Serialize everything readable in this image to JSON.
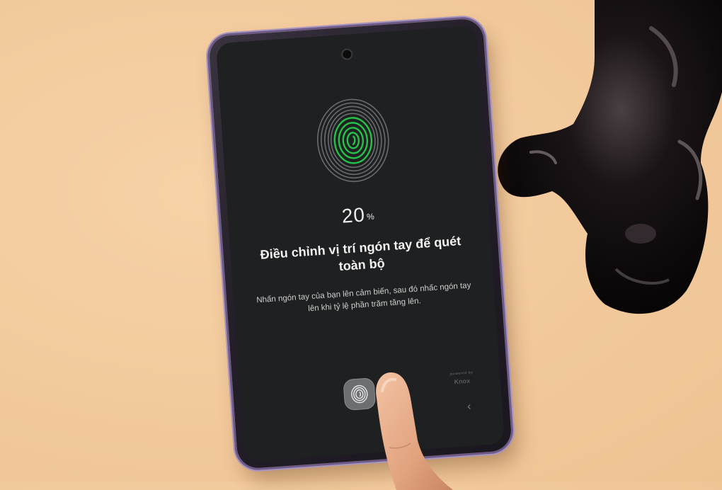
{
  "screen": {
    "progress_value": "20",
    "progress_unit": "%",
    "title": "Điều chỉnh vị trí ngón tay để quét toàn bộ",
    "hint": "Nhấn ngón tay của bạn lên cảm biến, sau đó nhấc ngón tay lên khi tỷ lệ phần trăm tăng lên.",
    "watermark_small": "powered by",
    "watermark_brand": "Knox",
    "progress_fraction": 0.2
  },
  "icons": {
    "fingerprint_main": "fingerprint-icon",
    "sensor": "fingerprint-icon",
    "back": "back-chevron-icon"
  },
  "colors": {
    "background": "#f2c99b",
    "screen": "#1f2021",
    "accent_green": "#25c24a",
    "fingerprint_gray": "#6a6b6e",
    "frame": "#8c7aa6"
  }
}
